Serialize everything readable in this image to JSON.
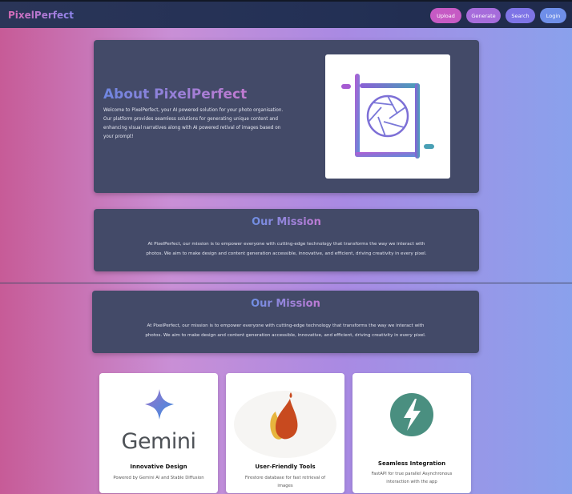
{
  "navbar": {
    "brand": "PixelPerfect",
    "upload": "Upload",
    "generate": "Generate",
    "search": "Search",
    "login": "Login"
  },
  "about": {
    "title": "About PixelPerfect",
    "text": "Welcome to PixelPerfect, your AI powered solution for your photo organisation. Our platform provides seamless solutions for generating unique content and enhancing visual narratives along with AI powered retival of images based on your prompt!",
    "logo_icon": "camera-aperture-crop-icon"
  },
  "mission": [
    {
      "title": "Our Mission",
      "text": "At PixelPerfect, our mission is to empower everyone with cutting-edge technology that transforms the way we interact with photos. We aim to make design and content generation accessible, innovative, and efficient, driving creativity in every pixel."
    },
    {
      "title": "Our Mission",
      "text": "At PixelPerfect, our mission is to empower everyone with cutting-edge technology that transforms the way we interact with photos. We aim to make design and content generation accessible, innovative, and efficient, driving creativity in every pixel."
    }
  ],
  "features": [
    {
      "title": "Innovative Design",
      "desc": "Powered by Gemini AI and Stable Diffusion",
      "logo_text": "Gemini",
      "icon": "gemini-sparkle-icon"
    },
    {
      "title": "User-Friendly Tools",
      "desc": "Firestore database for fast retrieval of images",
      "icon": "firestore-flame-icon"
    },
    {
      "title": "Seamless Integration",
      "desc": "FastAPI for true parallel Asynchronous interaction with the app",
      "icon": "fastapi-bolt-icon"
    }
  ],
  "colors": {
    "card_bg": "#434a68",
    "navbar_bg": "#233055",
    "upload_btn": "#c65ac4",
    "generate_btn": "#a66cdb",
    "search_btn": "#7e74e6",
    "login_btn": "#6f8fe9"
  }
}
